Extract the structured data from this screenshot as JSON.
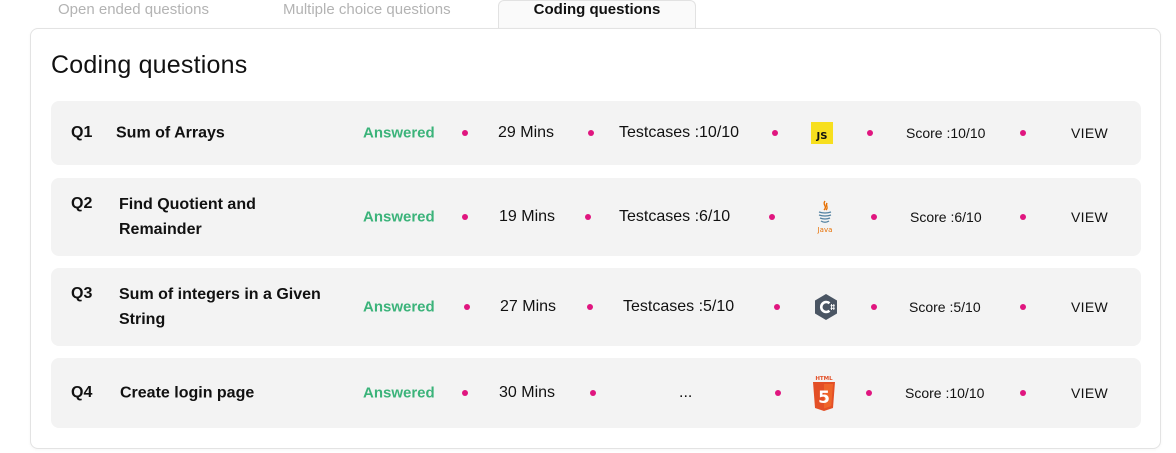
{
  "tabs": [
    {
      "label": "Open ended questions"
    },
    {
      "label": "Multiple choice questions"
    },
    {
      "label": "Coding questions"
    }
  ],
  "section_title": "Coding questions",
  "questions": [
    {
      "num": "Q1",
      "title": "Sum of Arrays",
      "status": "Answered",
      "time": "29 Mins",
      "testcases": "Testcases :10/10",
      "language_icon": "javascript-icon",
      "language_text": "JS",
      "score": "Score :10/10",
      "action": "VIEW"
    },
    {
      "num": "Q2",
      "title": "Find Quotient and Remainder",
      "status": "Answered",
      "time": "19 Mins",
      "testcases": "Testcases :6/10",
      "language_icon": "java-icon",
      "language_text": "Java",
      "score": "Score :6/10",
      "action": "VIEW"
    },
    {
      "num": "Q3",
      "title": "Sum of integers in a Given String",
      "status": "Answered",
      "time": "27 Mins",
      "testcases": "Testcases :5/10",
      "language_icon": "csharp-icon",
      "score": "Score :5/10",
      "action": "VIEW"
    },
    {
      "num": "Q4",
      "title": "Create login page",
      "status": "Answered",
      "time": "30 Mins",
      "testcases": "...",
      "language_icon": "html5-icon",
      "language_text": "HTML",
      "score": "Score :10/10",
      "action": "VIEW"
    }
  ],
  "colors": {
    "accent_dot": "#e0157f",
    "answered": "#3bb37a",
    "row_bg": "#f3f3f3"
  }
}
